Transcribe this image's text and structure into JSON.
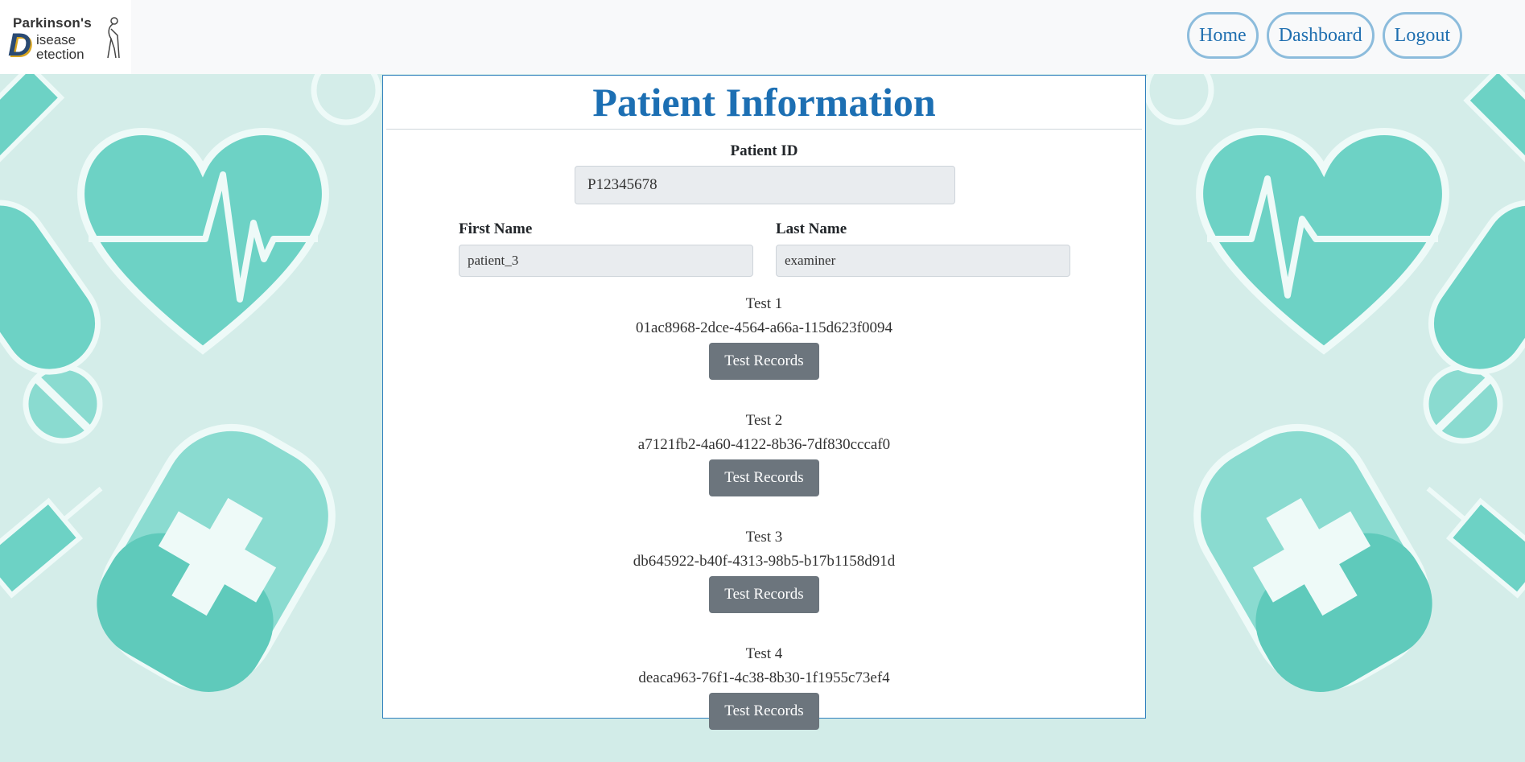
{
  "logo": {
    "line1": "Parkinson's",
    "letter1": "D",
    "line2": "isease",
    "line3": "etection",
    "icon": "elderly-person-cane-icon"
  },
  "nav": {
    "home": "Home",
    "dashboard": "Dashboard",
    "logout": "Logout"
  },
  "page": {
    "title": "Patient Information"
  },
  "form": {
    "patient_id_label": "Patient ID",
    "patient_id_value": "P12345678",
    "first_name_label": "First Name",
    "first_name_value": "patient_3",
    "last_name_label": "Last Name",
    "last_name_value": "examiner"
  },
  "tests": [
    {
      "label": "Test 1",
      "id": "01ac8968-2dce-4564-a66a-115d623f0094",
      "button": "Test Records"
    },
    {
      "label": "Test 2",
      "id": "a7121fb2-4a60-4122-8b36-7df830cccaf0",
      "button": "Test Records"
    },
    {
      "label": "Test 3",
      "id": "db645922-b40f-4313-98b5-b17b1158d91d",
      "button": "Test Records"
    },
    {
      "label": "Test 4",
      "id": "deaca963-76f1-4c38-8b30-1f1955c73ef4",
      "button": "Test Records"
    }
  ],
  "colors": {
    "accent": "#1c6fb3",
    "button_gray": "#6c757d",
    "nav_border": "#8cbcdc",
    "background_teal": "#6fcfc0"
  }
}
